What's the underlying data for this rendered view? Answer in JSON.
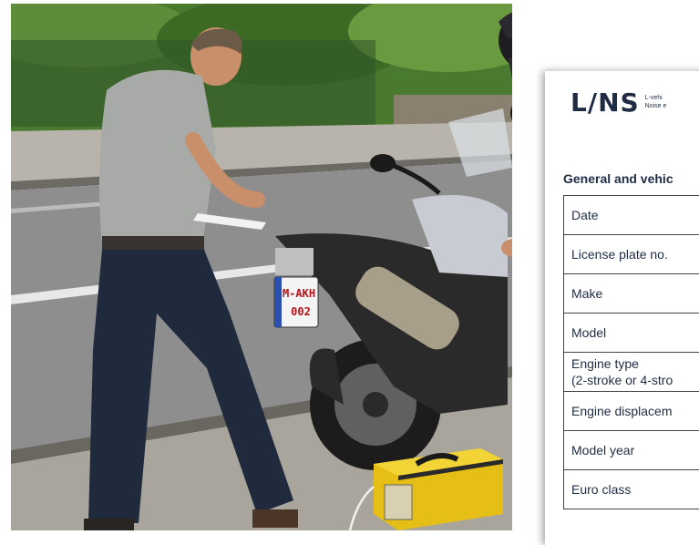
{
  "form": {
    "logo": "L/NS",
    "logo_sub_1": "L-vehi",
    "logo_sub_2": "Noise e",
    "section_title": "General and vehic",
    "rows": [
      {
        "label": "Date"
      },
      {
        "label": "License plate no."
      },
      {
        "label": "Make"
      },
      {
        "label": "Model"
      },
      {
        "label": "Engine type",
        "label2": "(2-stroke or 4-stro"
      },
      {
        "label": "Engine displacem"
      },
      {
        "label": "Model year"
      },
      {
        "label": "Euro class"
      }
    ]
  },
  "plate": {
    "line1": "M-AKH",
    "line2": "002"
  },
  "colors": {
    "road": "#8c8c8c",
    "hedge": "#3f6b2a",
    "meter": "#e8c21a",
    "motorcycle": "#2a2a2a",
    "form_text": "#1f2c44"
  }
}
